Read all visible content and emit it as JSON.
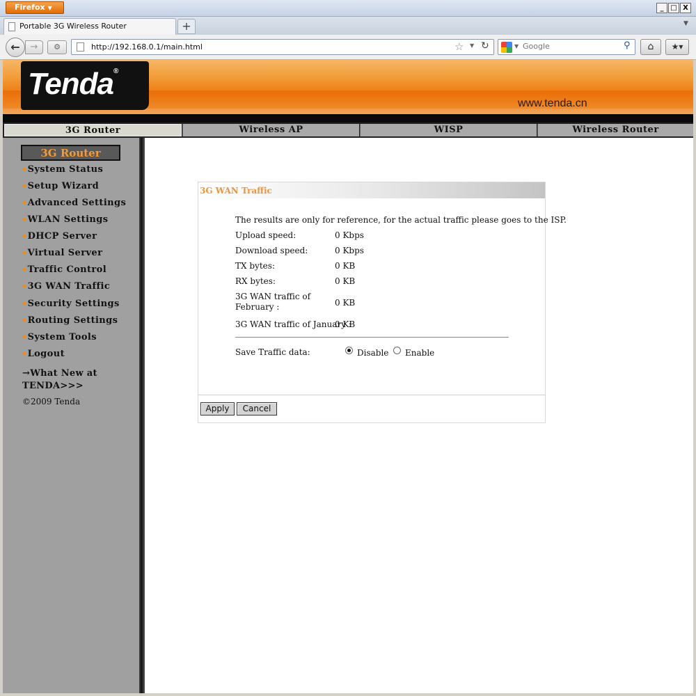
{
  "browser": {
    "app_menu_label": "Firefox",
    "tab_title": "Portable 3G Wireless Router",
    "url": "http://192.168.0.1/main.html",
    "search_placeholder": "Google",
    "window_buttons": [
      "_",
      "□",
      "X"
    ]
  },
  "banner": {
    "logo_text": "Tenda",
    "logo_mark": "®",
    "site_url": "www.tenda.cn"
  },
  "mode_tabs": [
    {
      "label": "3G Router",
      "active": true
    },
    {
      "label": "Wireless AP",
      "active": false
    },
    {
      "label": "WISP",
      "active": false
    },
    {
      "label": "Wireless Router",
      "active": false
    }
  ],
  "sidebar": {
    "title": "3G Router",
    "items": [
      {
        "label": "System Status"
      },
      {
        "label": "Setup Wizard"
      },
      {
        "label": "Advanced Settings"
      },
      {
        "label": "WLAN Settings"
      },
      {
        "label": "DHCP Server"
      },
      {
        "label": "Virtual Server"
      },
      {
        "label": "Traffic Control"
      },
      {
        "label": "3G WAN Traffic"
      },
      {
        "label": "Security Settings"
      },
      {
        "label": "Routing Settings"
      },
      {
        "label": "System Tools"
      },
      {
        "label": "Logout"
      }
    ],
    "whats_new": "→What New at TENDA>>>",
    "copyright": "©2009 Tenda"
  },
  "panel": {
    "title": "3G WAN Traffic",
    "note": "The results are only for reference, for the actual traffic please goes to the ISP.",
    "rows": [
      {
        "label": "Upload speed:",
        "value": "0 Kbps"
      },
      {
        "label": "Download speed:",
        "value": "0 Kbps"
      },
      {
        "label": "TX bytes:",
        "value": "0 KB"
      },
      {
        "label": "RX bytes:",
        "value": "0 KB"
      },
      {
        "label": "3G WAN traffic of February :",
        "value": "0 KB"
      },
      {
        "label": "3G WAN traffic of January :",
        "value": "0 KB"
      }
    ],
    "save_traffic": {
      "label": "Save Traffic data:",
      "options": [
        {
          "label": "Disable",
          "checked": true
        },
        {
          "label": "Enable",
          "checked": false
        }
      ]
    },
    "buttons": {
      "apply": "Apply",
      "cancel": "Cancel"
    }
  },
  "colors": {
    "accent_orange": "#f0933a",
    "sidebar_bg": "#a0a0a0",
    "banner_orange": "#ee7c12"
  }
}
